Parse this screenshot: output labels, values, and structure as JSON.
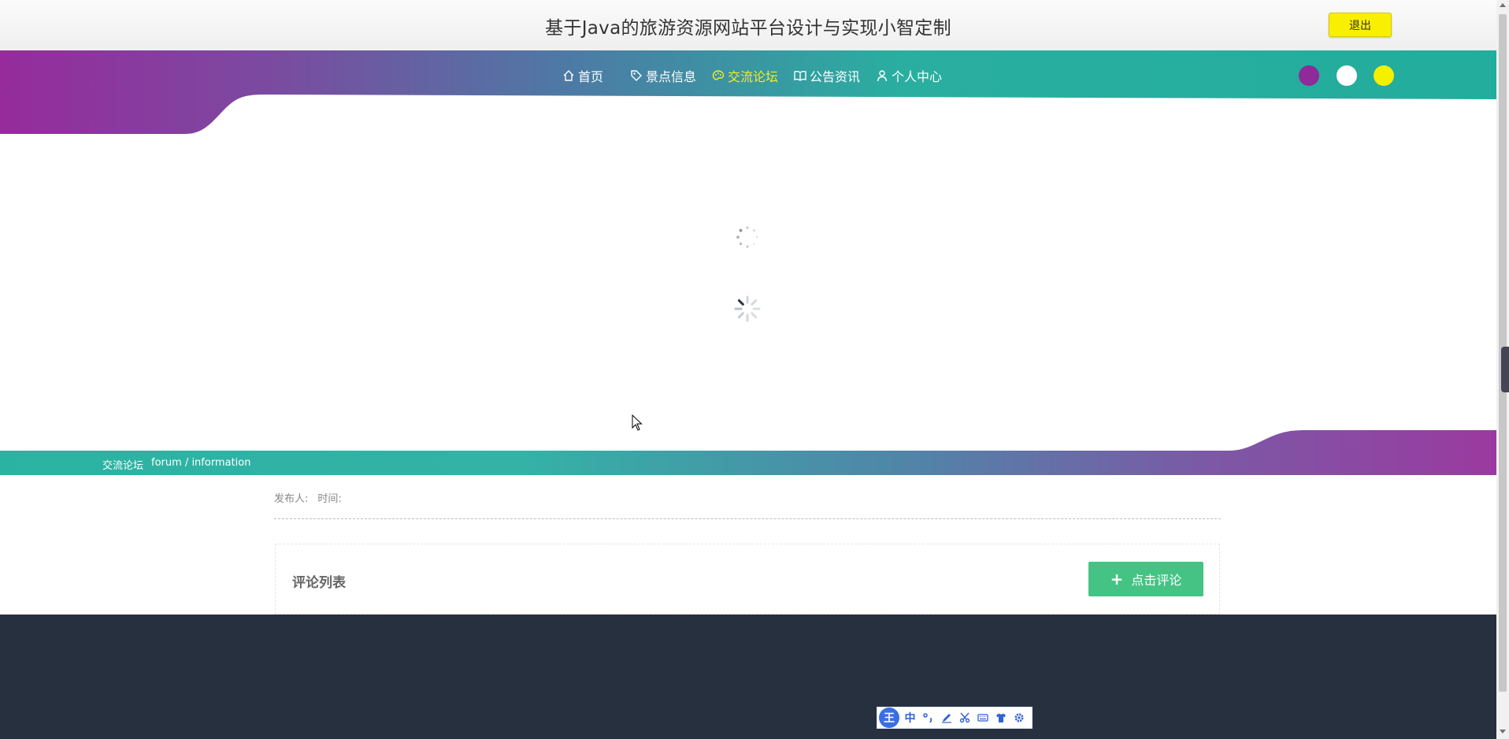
{
  "header": {
    "title": "基于Java的旅游资源网站平台设计与实现小智定制",
    "logout_label": "退出"
  },
  "nav": {
    "items": [
      {
        "label": "首页",
        "icon": "home-icon",
        "active": false
      },
      {
        "label": "景点信息",
        "icon": "tag-icon",
        "active": false
      },
      {
        "label": "交流论坛",
        "icon": "palette-icon",
        "active": true
      },
      {
        "label": "公告资讯",
        "icon": "book-icon",
        "active": false
      },
      {
        "label": "个人中心",
        "icon": "user-icon",
        "active": false
      }
    ],
    "active_color": "#f5ef24"
  },
  "theme_dots": [
    {
      "name": "purple",
      "color": "#8f2a9a"
    },
    {
      "name": "white",
      "color": "#ffffff"
    },
    {
      "name": "yellow",
      "color": "#f5ef00"
    }
  ],
  "breadcrumb": {
    "title": "交流论坛",
    "sub": "forum / information"
  },
  "post": {
    "publisher_label": "发布人:",
    "time_label": "时间:"
  },
  "comments": {
    "title": "评论列表",
    "add_button": "点击评论"
  },
  "ime": {
    "logo": "王",
    "mode": "中"
  },
  "colors": {
    "teal": "#2aaea0",
    "purple": "#942c9b",
    "comment_button": "#45c384",
    "footer": "#27303f",
    "logout": "#f9ef00"
  }
}
